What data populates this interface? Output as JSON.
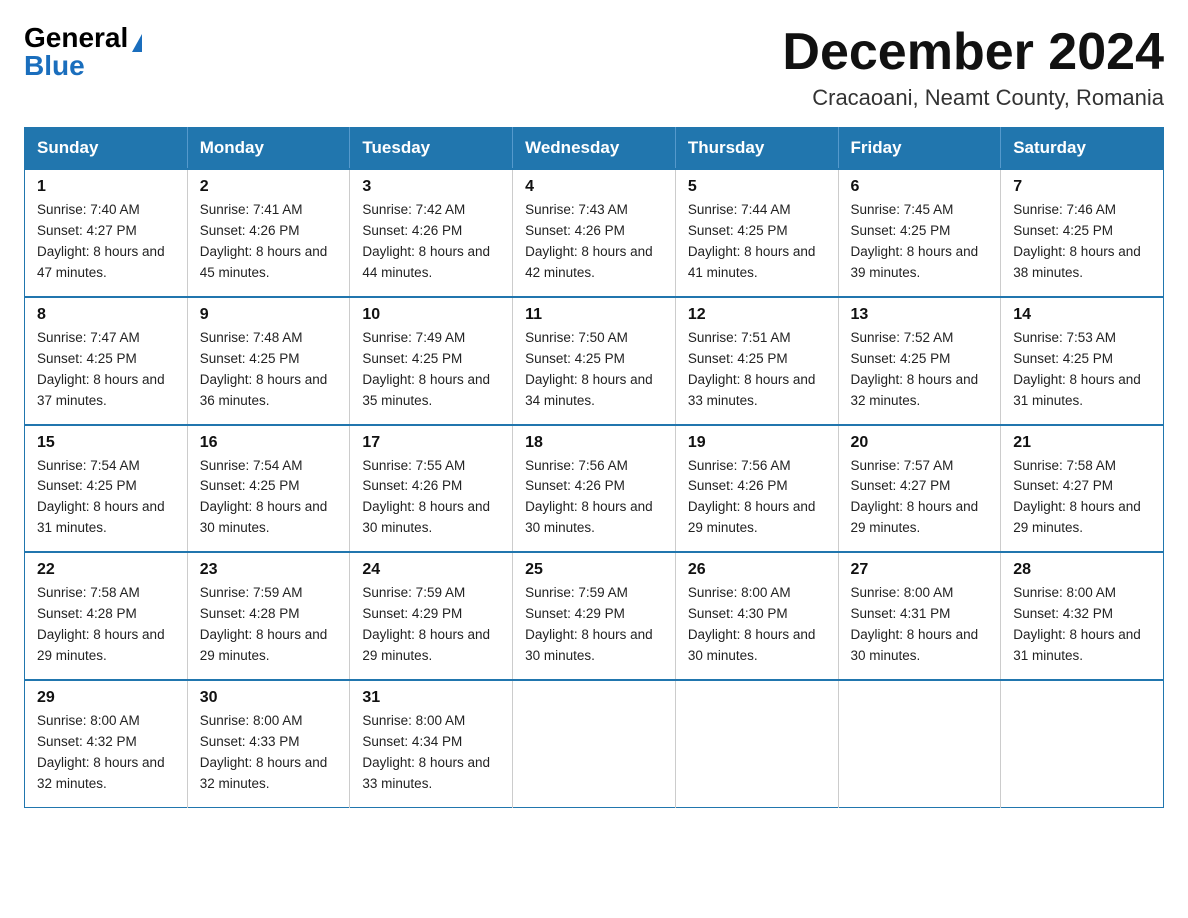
{
  "header": {
    "logo_general": "General",
    "logo_blue": "Blue",
    "month_title": "December 2024",
    "location": "Cracaoani, Neamt County, Romania"
  },
  "days_of_week": [
    "Sunday",
    "Monday",
    "Tuesday",
    "Wednesday",
    "Thursday",
    "Friday",
    "Saturday"
  ],
  "weeks": [
    [
      {
        "day": "1",
        "sunrise": "7:40 AM",
        "sunset": "4:27 PM",
        "daylight": "8 hours and 47 minutes."
      },
      {
        "day": "2",
        "sunrise": "7:41 AM",
        "sunset": "4:26 PM",
        "daylight": "8 hours and 45 minutes."
      },
      {
        "day": "3",
        "sunrise": "7:42 AM",
        "sunset": "4:26 PM",
        "daylight": "8 hours and 44 minutes."
      },
      {
        "day": "4",
        "sunrise": "7:43 AM",
        "sunset": "4:26 PM",
        "daylight": "8 hours and 42 minutes."
      },
      {
        "day": "5",
        "sunrise": "7:44 AM",
        "sunset": "4:25 PM",
        "daylight": "8 hours and 41 minutes."
      },
      {
        "day": "6",
        "sunrise": "7:45 AM",
        "sunset": "4:25 PM",
        "daylight": "8 hours and 39 minutes."
      },
      {
        "day": "7",
        "sunrise": "7:46 AM",
        "sunset": "4:25 PM",
        "daylight": "8 hours and 38 minutes."
      }
    ],
    [
      {
        "day": "8",
        "sunrise": "7:47 AM",
        "sunset": "4:25 PM",
        "daylight": "8 hours and 37 minutes."
      },
      {
        "day": "9",
        "sunrise": "7:48 AM",
        "sunset": "4:25 PM",
        "daylight": "8 hours and 36 minutes."
      },
      {
        "day": "10",
        "sunrise": "7:49 AM",
        "sunset": "4:25 PM",
        "daylight": "8 hours and 35 minutes."
      },
      {
        "day": "11",
        "sunrise": "7:50 AM",
        "sunset": "4:25 PM",
        "daylight": "8 hours and 34 minutes."
      },
      {
        "day": "12",
        "sunrise": "7:51 AM",
        "sunset": "4:25 PM",
        "daylight": "8 hours and 33 minutes."
      },
      {
        "day": "13",
        "sunrise": "7:52 AM",
        "sunset": "4:25 PM",
        "daylight": "8 hours and 32 minutes."
      },
      {
        "day": "14",
        "sunrise": "7:53 AM",
        "sunset": "4:25 PM",
        "daylight": "8 hours and 31 minutes."
      }
    ],
    [
      {
        "day": "15",
        "sunrise": "7:54 AM",
        "sunset": "4:25 PM",
        "daylight": "8 hours and 31 minutes."
      },
      {
        "day": "16",
        "sunrise": "7:54 AM",
        "sunset": "4:25 PM",
        "daylight": "8 hours and 30 minutes."
      },
      {
        "day": "17",
        "sunrise": "7:55 AM",
        "sunset": "4:26 PM",
        "daylight": "8 hours and 30 minutes."
      },
      {
        "day": "18",
        "sunrise": "7:56 AM",
        "sunset": "4:26 PM",
        "daylight": "8 hours and 30 minutes."
      },
      {
        "day": "19",
        "sunrise": "7:56 AM",
        "sunset": "4:26 PM",
        "daylight": "8 hours and 29 minutes."
      },
      {
        "day": "20",
        "sunrise": "7:57 AM",
        "sunset": "4:27 PM",
        "daylight": "8 hours and 29 minutes."
      },
      {
        "day": "21",
        "sunrise": "7:58 AM",
        "sunset": "4:27 PM",
        "daylight": "8 hours and 29 minutes."
      }
    ],
    [
      {
        "day": "22",
        "sunrise": "7:58 AM",
        "sunset": "4:28 PM",
        "daylight": "8 hours and 29 minutes."
      },
      {
        "day": "23",
        "sunrise": "7:59 AM",
        "sunset": "4:28 PM",
        "daylight": "8 hours and 29 minutes."
      },
      {
        "day": "24",
        "sunrise": "7:59 AM",
        "sunset": "4:29 PM",
        "daylight": "8 hours and 29 minutes."
      },
      {
        "day": "25",
        "sunrise": "7:59 AM",
        "sunset": "4:29 PM",
        "daylight": "8 hours and 30 minutes."
      },
      {
        "day": "26",
        "sunrise": "8:00 AM",
        "sunset": "4:30 PM",
        "daylight": "8 hours and 30 minutes."
      },
      {
        "day": "27",
        "sunrise": "8:00 AM",
        "sunset": "4:31 PM",
        "daylight": "8 hours and 30 minutes."
      },
      {
        "day": "28",
        "sunrise": "8:00 AM",
        "sunset": "4:32 PM",
        "daylight": "8 hours and 31 minutes."
      }
    ],
    [
      {
        "day": "29",
        "sunrise": "8:00 AM",
        "sunset": "4:32 PM",
        "daylight": "8 hours and 32 minutes."
      },
      {
        "day": "30",
        "sunrise": "8:00 AM",
        "sunset": "4:33 PM",
        "daylight": "8 hours and 32 minutes."
      },
      {
        "day": "31",
        "sunrise": "8:00 AM",
        "sunset": "4:34 PM",
        "daylight": "8 hours and 33 minutes."
      },
      null,
      null,
      null,
      null
    ]
  ]
}
